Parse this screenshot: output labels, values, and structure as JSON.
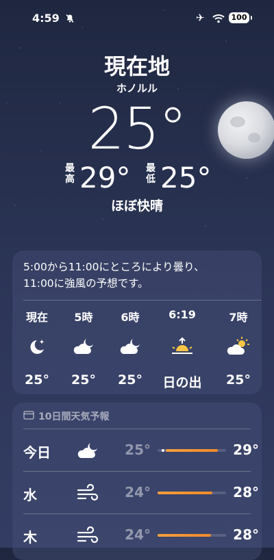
{
  "status": {
    "time": "4:59",
    "battery": "100",
    "icons": [
      "bell-slash-icon",
      "airplane-icon",
      "wifi-icon",
      "battery-icon"
    ]
  },
  "header": {
    "location": "現在地",
    "city": "ホノルル",
    "temperature": "25°",
    "high_label": "最高",
    "high": "29°",
    "low_label": "最低",
    "low": "25°",
    "condition": "ほぼ快晴"
  },
  "hourly": {
    "summary_line1": "5:00から11:00にところにより曇り、",
    "summary_line2": "11:00に強風の予想です。",
    "items": [
      {
        "label": "現在",
        "icon": "moon-stars-icon",
        "temp": "25°"
      },
      {
        "label": "5時",
        "icon": "cloud-moon-icon",
        "temp": "25°"
      },
      {
        "label": "6時",
        "icon": "cloud-moon-icon",
        "temp": "25°"
      },
      {
        "label": "6:19",
        "icon": "sunrise-icon",
        "temp": "日の出"
      },
      {
        "label": "7時",
        "icon": "cloud-sun-icon",
        "temp": "25°"
      }
    ]
  },
  "daily": {
    "title": "10日間天気予報",
    "items": [
      {
        "day": "今日",
        "icon": "cloud-moon-icon",
        "low": "25°",
        "high": "29°",
        "range": [
          0.12,
          0.88
        ]
      },
      {
        "day": "水",
        "icon": "wind-icon",
        "low": "24°",
        "high": "28°",
        "range": [
          0.0,
          0.8
        ]
      },
      {
        "day": "木",
        "icon": "wind-icon",
        "low": "24°",
        "high": "28°",
        "range": [
          0.0,
          0.78
        ]
      }
    ]
  },
  "colors": {
    "accent_bar": "#f3a03b",
    "sun": "#f6c544"
  }
}
